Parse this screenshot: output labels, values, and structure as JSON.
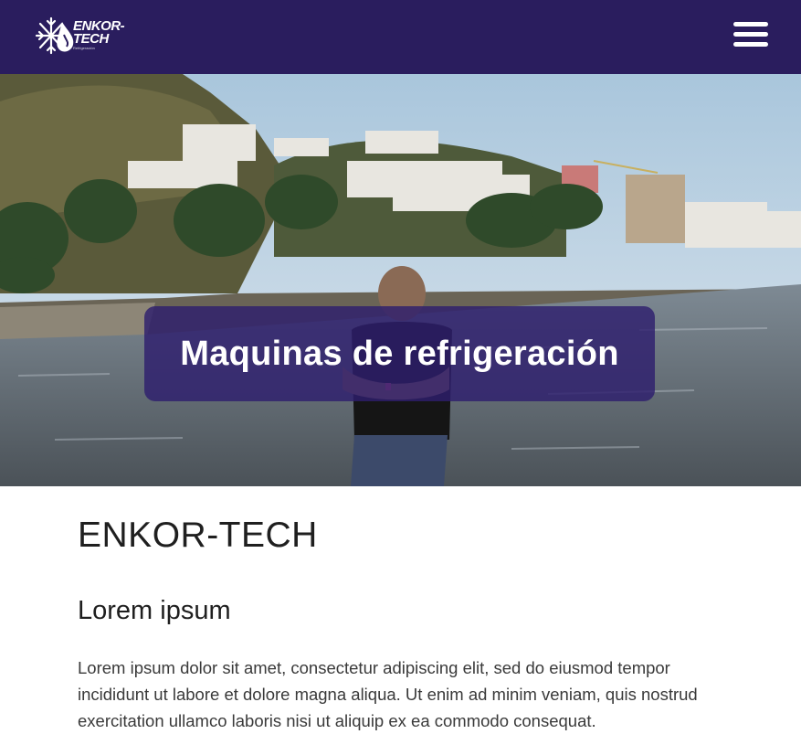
{
  "header": {
    "logo_text_line1": "ENKOR-",
    "logo_text_line2": "TECH",
    "logo_tagline": "Refrigeración",
    "menu_icon": "hamburger-menu-icon"
  },
  "hero": {
    "title": "Maquinas de refrigeración"
  },
  "main": {
    "brand_heading": "ENKOR-TECH",
    "section_heading": "Lorem ipsum",
    "paragraph": "Lorem ipsum dolor sit amet, consectetur adipiscing elit, sed do eiusmod tempor incididunt ut labore et dolore magna aliqua. Ut enim ad minim veniam, quis nostrud exercitation ullamco laboris nisi ut aliquip ex ea commodo consequat."
  },
  "colors": {
    "navbar": "#2a1d5e",
    "hero_overlay": "#2e1e6e",
    "text": "#2b2b2b"
  }
}
